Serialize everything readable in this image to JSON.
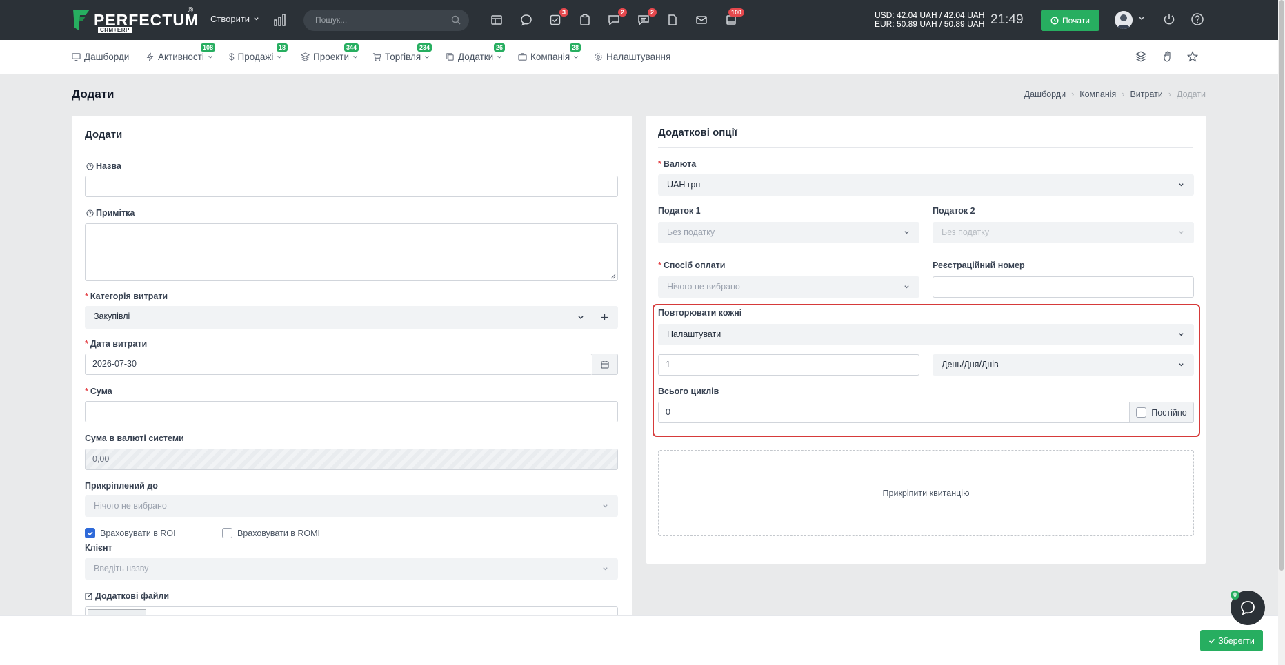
{
  "header": {
    "logo_text": "PERFECTUM",
    "logo_sub": "CRM+ERP",
    "logo_reg": "®",
    "create_label": "Створити",
    "search_placeholder": "Пошук...",
    "badges": {
      "tasks": "3",
      "chat": "2",
      "messages": "2",
      "notifications": "100"
    },
    "rate_usd": "USD: 42.04 UAH / 42.04 UAH",
    "rate_eur": "EUR: 50.89 UAH / 50.89 UAH",
    "time": "21:49",
    "start_label": "Почати"
  },
  "nav": {
    "items": [
      {
        "label": "Дашборди",
        "badge": ""
      },
      {
        "label": "Активності",
        "badge": "108"
      },
      {
        "label": "Продажі",
        "badge": "18"
      },
      {
        "label": "Проекти",
        "badge": "344"
      },
      {
        "label": "Торгівля",
        "badge": "234"
      },
      {
        "label": "Додатки",
        "badge": "26"
      },
      {
        "label": "Компанія",
        "badge": "28"
      },
      {
        "label": "Налаштування",
        "badge": ""
      }
    ]
  },
  "page": {
    "title": "Додати",
    "breadcrumb": [
      "Дашборди",
      "Компанія",
      "Витрати",
      "Додати"
    ]
  },
  "left_card": {
    "title": "Додати",
    "name_label": "Назва",
    "name_value": "",
    "note_label": "Примітка",
    "category_label": "Категорія витрати",
    "category_value": "Закупівлі",
    "date_label": "Дата витрати",
    "date_value": "2026-07-30",
    "amount_label": "Сума",
    "amount_value": "",
    "system_amount_label": "Сума в валюті системи",
    "system_amount_value": "0,00",
    "attached_label": "Прикріплений до",
    "attached_value": "Нічого не вибрано",
    "roi_label": "Враховувати в ROI",
    "roi_checked": true,
    "romi_label": "Враховувати в ROMI",
    "romi_checked": false,
    "client_label": "Клієнт",
    "client_placeholder": "Введіть назву",
    "files_label": "Додаткові файли"
  },
  "right_card": {
    "title": "Додаткові опції",
    "currency_label": "Валюта",
    "currency_value": "UAH грн",
    "tax1_label": "Податок 1",
    "tax1_value": "Без податку",
    "tax2_label": "Податок 2",
    "tax2_value": "Без податку",
    "payment_label": "Спосіб оплати",
    "payment_value": "Нічого не вибрано",
    "reg_number_label": "Реєстраційний номер",
    "reg_number_value": "",
    "repeat_label": "Повторювати кожні",
    "repeat_value": "Налаштувати",
    "repeat_count": "1",
    "repeat_unit": "День/Дня/Днів",
    "cycles_label": "Всього циклів",
    "cycles_value": "0",
    "permanent_label": "Постійно",
    "receipt_label": "Прикріпити квитанцію"
  },
  "footer": {
    "save_label": "Зберегти",
    "chat_badge": "0"
  },
  "colors": {
    "topbar": "#2b3137",
    "accent_green": "#27ae60",
    "badge_red": "#e5484d",
    "highlight_red": "#d63a3a",
    "checkbox_blue": "#2f6ad9"
  }
}
